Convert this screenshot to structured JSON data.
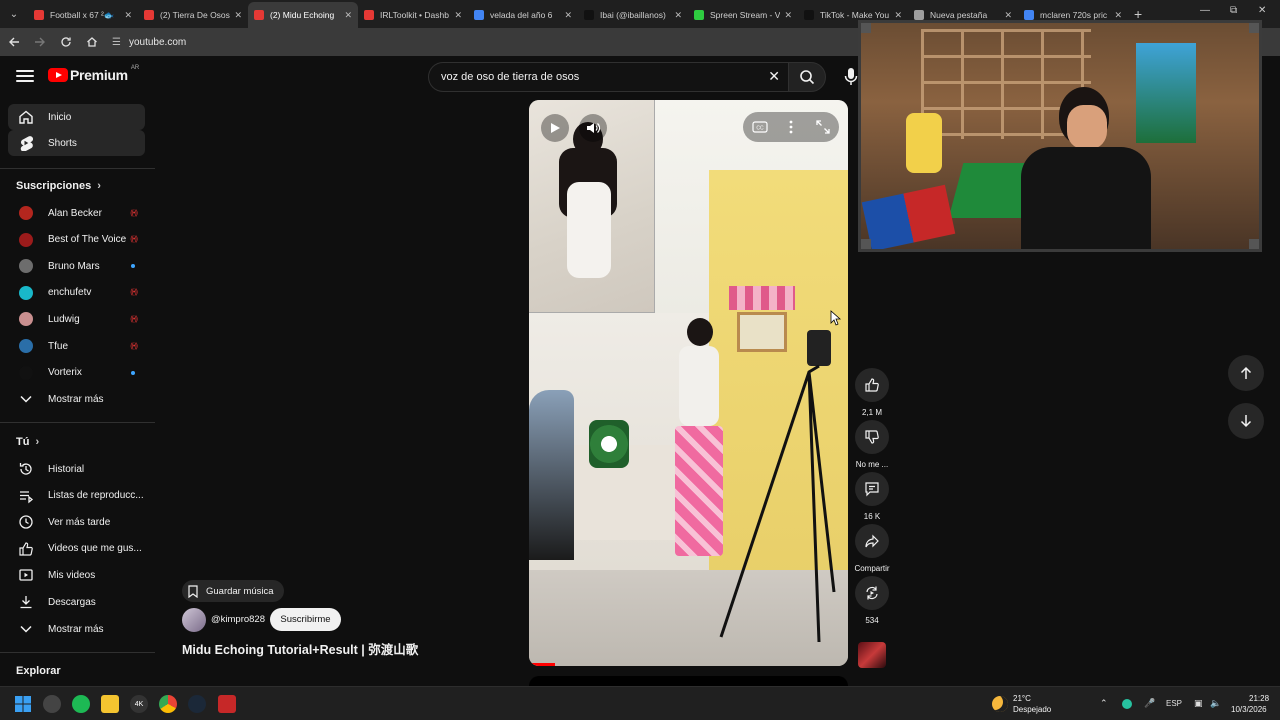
{
  "browser": {
    "tabs": [
      {
        "title": "Football x 67 ²🐟",
        "color": "#e53935"
      },
      {
        "title": "(2) Tierra De Osos",
        "color": "#e53935"
      },
      {
        "title": "(2) Midu Echoing",
        "color": "#e53935",
        "active": true
      },
      {
        "title": "IRLToolkit • Dashb",
        "color": "#e53935"
      },
      {
        "title": "velada del año 6",
        "color": "#4285f4"
      },
      {
        "title": "Ibai (@ibaillanos)",
        "color": "#111111"
      },
      {
        "title": "Spreen Stream - V",
        "color": "#2ecc40"
      },
      {
        "title": "TikTok - Make You",
        "color": "#111111"
      },
      {
        "title": "Nueva pestaña",
        "color": "#9e9e9e"
      },
      {
        "title": "mclaren 720s pric",
        "color": "#4285f4"
      }
    ],
    "url": "youtube.com"
  },
  "header": {
    "logo_text": "Premium",
    "country_code": "AR",
    "search_value": "voz de oso de tierra de osos"
  },
  "sidebar": {
    "main": [
      {
        "label": "Inicio",
        "icon": "home-icon",
        "selected": true
      },
      {
        "label": "Shorts",
        "icon": "shorts-icon",
        "selected": true
      }
    ],
    "subscriptions_title": "Suscripciones",
    "subscriptions": [
      {
        "label": "Alan Becker",
        "avatar_color": "#b3261e",
        "status": "live"
      },
      {
        "label": "Best of The Voice",
        "avatar_color": "#9b1b1b",
        "status": "live"
      },
      {
        "label": "Bruno Mars",
        "avatar_color": "#6d6d6d",
        "status": "new"
      },
      {
        "label": "enchufetv",
        "avatar_color": "#19b8c9",
        "status": "live"
      },
      {
        "label": "Ludwig",
        "avatar_color": "#c98f8f",
        "status": "live"
      },
      {
        "label": "Tfue",
        "avatar_color": "#2a6ea8",
        "status": "live"
      },
      {
        "label": "Vorterix",
        "avatar_color": "#111111",
        "status": "new"
      }
    ],
    "show_more": "Mostrar más",
    "you_title": "Tú",
    "you_items": [
      {
        "label": "Historial",
        "icon": "history-icon"
      },
      {
        "label": "Listas de reproducc...",
        "icon": "playlist-icon"
      },
      {
        "label": "Ver más tarde",
        "icon": "clock-icon"
      },
      {
        "label": "Videos que me gus...",
        "icon": "thumbs-up-icon"
      },
      {
        "label": "Mis videos",
        "icon": "my-videos-icon"
      },
      {
        "label": "Descargas",
        "icon": "download-icon"
      }
    ],
    "show_more_2": "Mostrar más",
    "explore_title": "Explorar"
  },
  "video": {
    "save_music": "Guardar música",
    "channel": "@kimpro828",
    "subscribe": "Suscribirme",
    "title": "Midu Echoing Tutorial+Result | 弥渡山歌",
    "progress": 0.08
  },
  "actions": {
    "likes": "2,1 M",
    "dislike": "No me ...",
    "comments": "16 K",
    "share": "Compartir",
    "remix": "534"
  },
  "taskbar": {
    "weather_temp": "21°C",
    "weather_desc": "Despejado",
    "lang": "ESP",
    "time": "21:28",
    "date": "10/3/2026"
  }
}
